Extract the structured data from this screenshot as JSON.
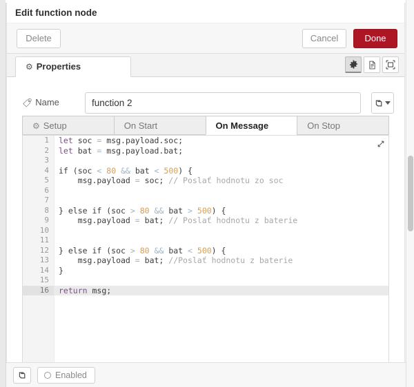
{
  "dialog": {
    "title": "Edit function node",
    "toolbar": {
      "delete_label": "Delete",
      "cancel_label": "Cancel",
      "done_label": "Done",
      "done_color": "#ad1625"
    },
    "properties_tab": {
      "label": "Properties",
      "icon": "gear-icon"
    },
    "tool_icons": [
      {
        "name": "gear-icon",
        "active": true
      },
      {
        "name": "document-icon",
        "active": false
      },
      {
        "name": "expand-node-icon",
        "active": false
      }
    ]
  },
  "name_field": {
    "label": "Name",
    "icon": "tag-icon",
    "value": "function 2",
    "placeholder": "Name",
    "menu_icon": "book-icon"
  },
  "code_tabs": [
    {
      "label": "Setup",
      "icon": "gear-icon",
      "active": false
    },
    {
      "label": "On Start",
      "icon": "",
      "active": false
    },
    {
      "label": "On Message",
      "icon": "",
      "active": true
    },
    {
      "label": "On Stop",
      "icon": "",
      "active": false
    }
  ],
  "editor": {
    "expand_icon": "expand-arrows-icon",
    "active_line": 16,
    "lines": [
      {
        "n": 1,
        "fold": "",
        "tokens": [
          {
            "t": "kw",
            "v": "let"
          },
          {
            "t": "pln",
            "v": " soc "
          },
          {
            "t": "op",
            "v": "="
          },
          {
            "t": "pln",
            "v": " msg.payload.soc;"
          }
        ]
      },
      {
        "n": 2,
        "fold": "",
        "tokens": [
          {
            "t": "kw",
            "v": "let"
          },
          {
            "t": "pln",
            "v": " bat "
          },
          {
            "t": "op",
            "v": "="
          },
          {
            "t": "pln",
            "v": " msg.payload.bat;"
          }
        ]
      },
      {
        "n": 3,
        "fold": "",
        "tokens": []
      },
      {
        "n": 4,
        "fold": "open",
        "tokens": [
          {
            "t": "pln",
            "v": "if (soc "
          },
          {
            "t": "op",
            "v": "<"
          },
          {
            "t": "pln",
            "v": " "
          },
          {
            "t": "num",
            "v": "80"
          },
          {
            "t": "pln",
            "v": " "
          },
          {
            "t": "op",
            "v": "&&"
          },
          {
            "t": "pln",
            "v": " bat "
          },
          {
            "t": "op",
            "v": "<"
          },
          {
            "t": "pln",
            "v": " "
          },
          {
            "t": "num",
            "v": "500"
          },
          {
            "t": "pln",
            "v": ") {"
          }
        ]
      },
      {
        "n": 5,
        "fold": "",
        "tokens": [
          {
            "t": "pln",
            "v": "    msg.payload "
          },
          {
            "t": "op",
            "v": "="
          },
          {
            "t": "pln",
            "v": " soc; "
          },
          {
            "t": "cmt",
            "v": "// Poslať hodnotu zo soc"
          }
        ]
      },
      {
        "n": 6,
        "fold": "",
        "tokens": []
      },
      {
        "n": 7,
        "fold": "",
        "tokens": []
      },
      {
        "n": 8,
        "fold": "open",
        "tokens": [
          {
            "t": "pln",
            "v": "} else if (soc "
          },
          {
            "t": "op",
            "v": ">"
          },
          {
            "t": "pln",
            "v": " "
          },
          {
            "t": "num",
            "v": "80"
          },
          {
            "t": "pln",
            "v": " "
          },
          {
            "t": "op",
            "v": "&&"
          },
          {
            "t": "pln",
            "v": " bat "
          },
          {
            "t": "op",
            "v": ">"
          },
          {
            "t": "pln",
            "v": " "
          },
          {
            "t": "num",
            "v": "500"
          },
          {
            "t": "pln",
            "v": ") {"
          }
        ]
      },
      {
        "n": 9,
        "fold": "",
        "tokens": [
          {
            "t": "pln",
            "v": "    msg.payload "
          },
          {
            "t": "op",
            "v": "="
          },
          {
            "t": "pln",
            "v": " bat; "
          },
          {
            "t": "cmt",
            "v": "// Poslať hodnotu z baterie"
          }
        ]
      },
      {
        "n": 10,
        "fold": "",
        "tokens": []
      },
      {
        "n": 11,
        "fold": "",
        "tokens": []
      },
      {
        "n": 12,
        "fold": "open",
        "tokens": [
          {
            "t": "pln",
            "v": "} else if (soc "
          },
          {
            "t": "op",
            "v": ">"
          },
          {
            "t": "pln",
            "v": " "
          },
          {
            "t": "num",
            "v": "80"
          },
          {
            "t": "pln",
            "v": " "
          },
          {
            "t": "op",
            "v": "&&"
          },
          {
            "t": "pln",
            "v": " bat "
          },
          {
            "t": "op",
            "v": "<"
          },
          {
            "t": "pln",
            "v": " "
          },
          {
            "t": "num",
            "v": "500"
          },
          {
            "t": "pln",
            "v": ") {"
          }
        ]
      },
      {
        "n": 13,
        "fold": "",
        "tokens": [
          {
            "t": "pln",
            "v": "    msg.payload "
          },
          {
            "t": "op",
            "v": "="
          },
          {
            "t": "pln",
            "v": " bat; "
          },
          {
            "t": "cmt",
            "v": "//Poslať hodnotu z baterie"
          }
        ]
      },
      {
        "n": 14,
        "fold": "close",
        "tokens": [
          {
            "t": "pln",
            "v": "}"
          }
        ]
      },
      {
        "n": 15,
        "fold": "",
        "tokens": []
      },
      {
        "n": 16,
        "fold": "",
        "tokens": [
          {
            "t": "kw",
            "v": "return"
          },
          {
            "t": "pln",
            "v": " msg;"
          }
        ]
      }
    ]
  },
  "footer": {
    "book_icon": "book-icon",
    "enabled_label": "Enabled",
    "enabled_icon": "radio-circle-icon"
  }
}
